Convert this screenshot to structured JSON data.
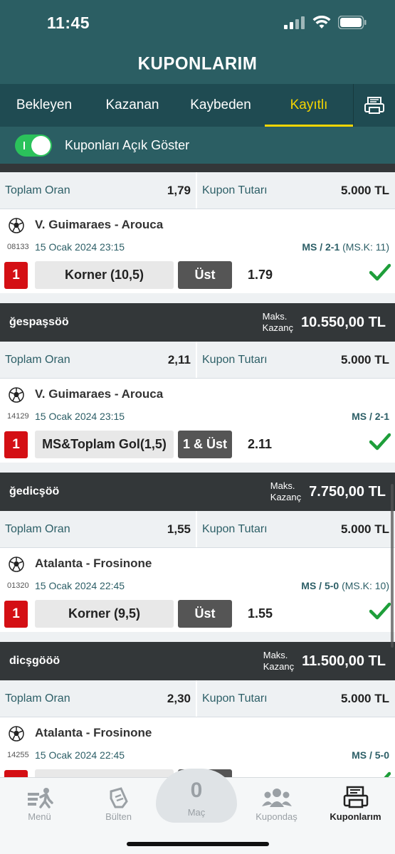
{
  "status": {
    "time": "11:45"
  },
  "header": {
    "title": "KUPONLARIM"
  },
  "tabs": [
    {
      "label": "Bekleyen"
    },
    {
      "label": "Kazanan"
    },
    {
      "label": "Kaybeden"
    },
    {
      "label": "Kayıtlı"
    }
  ],
  "active_tab": "Kayıtlı",
  "toggle": {
    "label": "Kuponları Açık Göster",
    "on": true
  },
  "labels": {
    "toplam_oran": "Toplam Oran",
    "kupon_tutari": "Kupon Tutarı",
    "maks": "Maks.",
    "kazanc": "Kazanç"
  },
  "coupons": [
    {
      "name": "",
      "max_win": "",
      "total_odds": "1,79",
      "amount": "5.000 TL",
      "match": {
        "teams": "V. Guimaraes - Arouca",
        "code": "08133",
        "date": "15 Ocak 2024 23:15",
        "result": "MS / 2-1",
        "result_extra": " (MS.K: 11)",
        "number": "1",
        "market": "Korner (10,5)",
        "pick": "Üst",
        "odd": "1.79"
      }
    },
    {
      "name": "ğespaşsöö",
      "max_win": "10.550,00 TL",
      "total_odds": "2,11",
      "amount": "5.000 TL",
      "match": {
        "teams": "V. Guimaraes - Arouca",
        "code": "14129",
        "date": "15 Ocak 2024 23:15",
        "result": "MS / 2-1",
        "result_extra": "",
        "number": "1",
        "market": "MS&Toplam Gol(1,5)",
        "pick": "1 & Üst",
        "odd": "2.11"
      }
    },
    {
      "name": "ğedicşöö",
      "max_win": "7.750,00 TL",
      "total_odds": "1,55",
      "amount": "5.000 TL",
      "match": {
        "teams": "Atalanta - Frosinone",
        "code": "01320",
        "date": "15 Ocak 2024 22:45",
        "result": "MS / 5-0",
        "result_extra": " (MS.K: 10)",
        "number": "1",
        "market": "Korner (9,5)",
        "pick": "Üst",
        "odd": "1.55"
      }
    },
    {
      "name": "dicşgööö",
      "max_win": "11.500,00 TL",
      "total_odds": "2,30",
      "amount": "5.000 TL",
      "match": {
        "teams": "Atalanta - Frosinone",
        "code": "14255",
        "date": "15 Ocak 2024 22:45",
        "result": "MS / 5-0",
        "result_extra": "",
        "number": "1",
        "market": "",
        "pick": "",
        "odd": ""
      }
    }
  ],
  "bottom_nav": [
    {
      "label": "Menü",
      "icon": "menu-runner-icon"
    },
    {
      "label": "Bülten",
      "icon": "bulletin-hand-icon"
    },
    {
      "label": "Maç",
      "icon": "match-count",
      "count": "0"
    },
    {
      "label": "Kupondaş",
      "icon": "people-icon"
    },
    {
      "label": "Kuponlarım",
      "icon": "coupons-icon"
    }
  ],
  "colors": {
    "header_bg": "#2b5e63",
    "tab_bg": "#1f4b52",
    "active_tab": "#f5d500",
    "toggle_on": "#2bc25b",
    "card_head": "#333739",
    "event_red": "#d40f14",
    "win_check": "#1e9e3a"
  }
}
